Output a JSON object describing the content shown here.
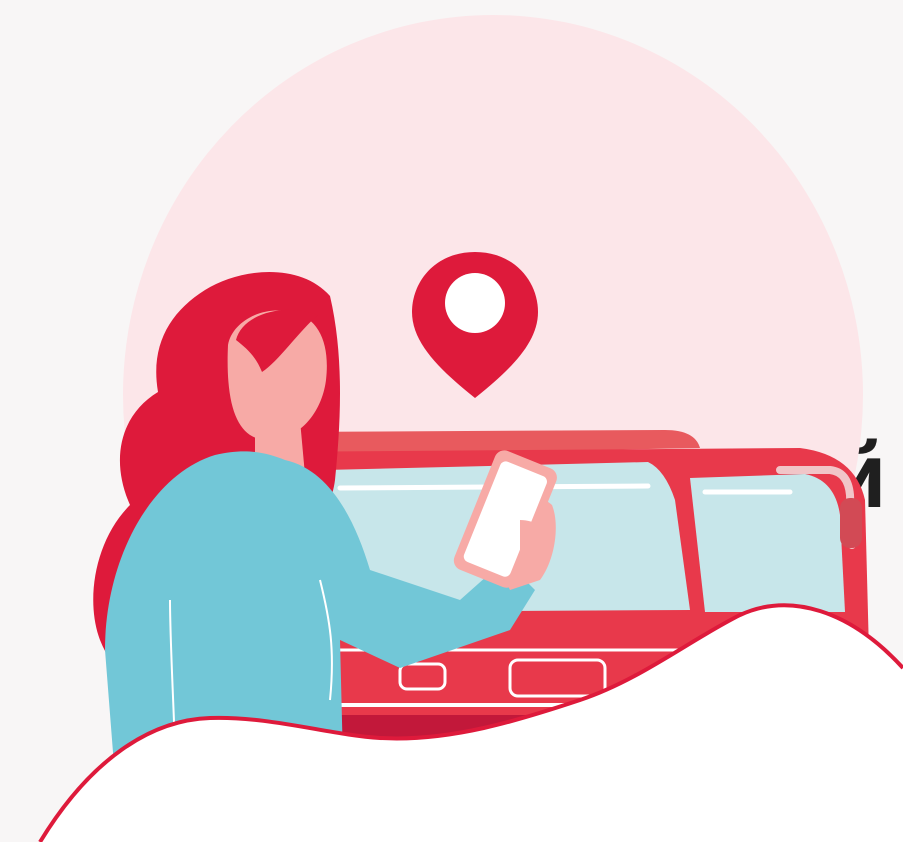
{
  "visible_text": {
    "cut_off_letter": "й"
  },
  "palette": {
    "background": "#f8f6f6",
    "circle": "#fce6e9",
    "brand_red": "#de1a3b",
    "bus_red": "#e8394b",
    "bus_dark": "#c2183a",
    "glass": "#c7e6ea",
    "sweater": "#72c7d7",
    "skin": "#f7aaa6",
    "hill": "#ffffff"
  },
  "icons": {
    "pin": "location-pin-icon",
    "phone": "smartphone"
  }
}
